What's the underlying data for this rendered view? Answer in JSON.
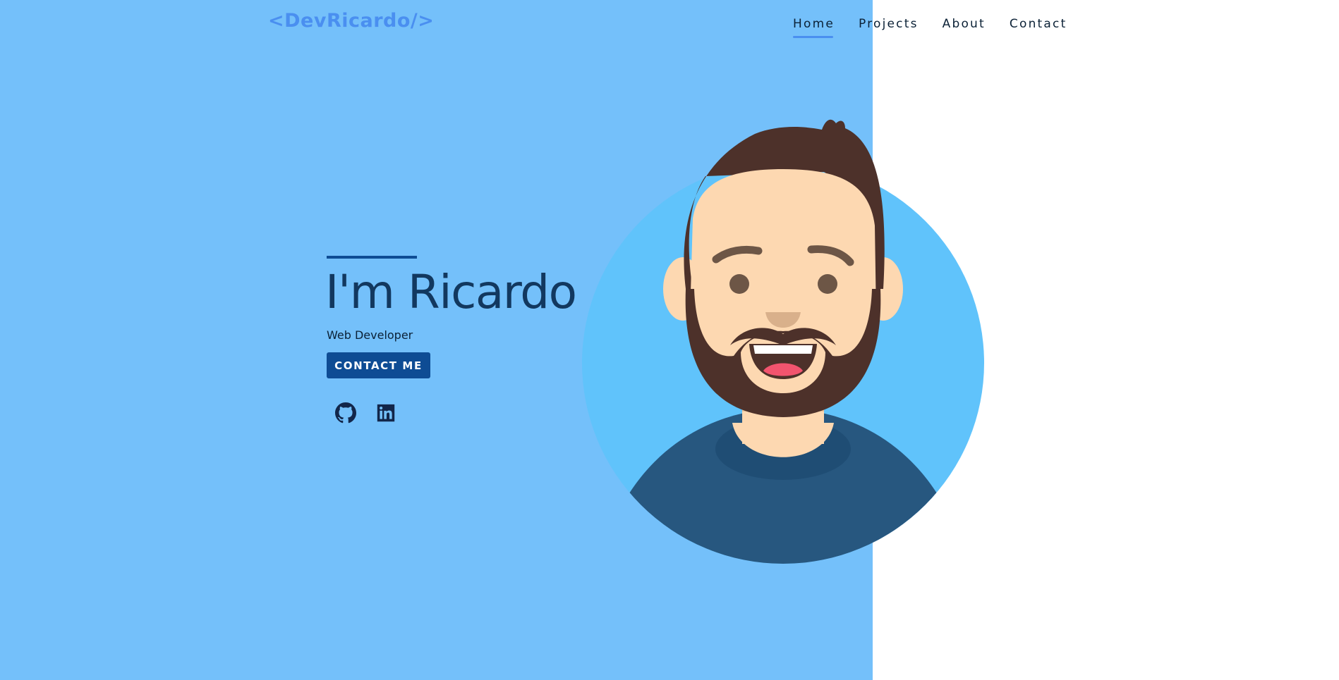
{
  "header": {
    "logo_text": "<DevRicardo/>"
  },
  "nav": {
    "items": [
      "Home",
      "Projects",
      "About",
      "Contact"
    ],
    "active_index": 0
  },
  "hero": {
    "title": "I'm Ricardo",
    "subtitle": "Web Developer",
    "cta_label": "CONTACT ME"
  },
  "social": {
    "icons": [
      "github-icon",
      "linkedin-icon"
    ]
  },
  "colors": {
    "left_panel_bg": "#74c0fa",
    "page_bg": "#ffffff",
    "logo": "#4a8ff0",
    "accent_dark": "#0e4c94",
    "title": "#12385f",
    "nav_text": "#0b2136",
    "nav_underline": "#4a8ff0",
    "avatar_circle": "#60c3fb",
    "shirt": "#27577f",
    "skin": "#fdd8b1",
    "hair": "#4d312a"
  }
}
